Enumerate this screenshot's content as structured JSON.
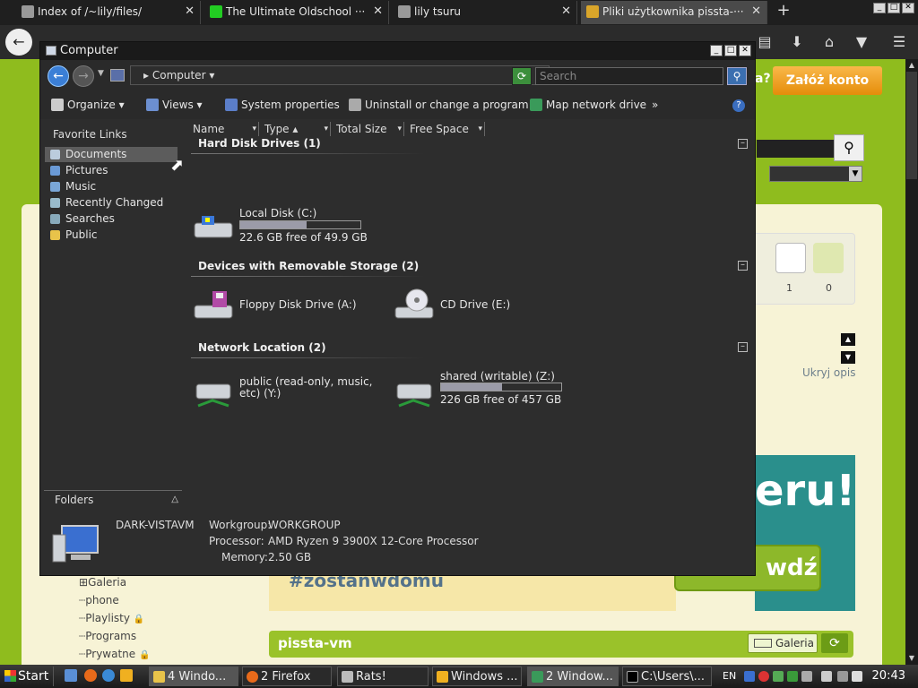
{
  "browser": {
    "tabs": [
      {
        "label": "Index of /~lily/files/",
        "close": "✕"
      },
      {
        "label": "The Ultimate Oldschool ···",
        "close": "✕"
      },
      {
        "label": "lily tsuru",
        "close": "✕"
      },
      {
        "label": "Pliki użytkownika pissta-···",
        "close": "✕"
      }
    ],
    "new_tab": "+",
    "win_buttons": [
      "_",
      "□",
      "✕"
    ]
  },
  "webpage": {
    "signup_button": "Załóż konto",
    "help_mark": "a?",
    "counts": [
      "1",
      "0"
    ],
    "hide_desc": "Ukryj opis",
    "banner_text": "eru!",
    "banner_button": "wdź",
    "hashtag": "#zostanwdomu",
    "tree": [
      "Galeria",
      "phone",
      "Playlisty",
      "Programs",
      "Prywatne"
    ],
    "section_title": "pissta-vm",
    "gallery_button": "Galeria"
  },
  "explorer": {
    "title": "Computer",
    "address": "Computer",
    "search_placeholder": "Search",
    "toolbar": {
      "organize": "Organize",
      "views": "Views",
      "system_properties": "System properties",
      "uninstall": "Uninstall or change a program",
      "map_drive": "Map network drive",
      "more": "»"
    },
    "favorites_header": "Favorite Links",
    "favorites": [
      "Documents",
      "Pictures",
      "Music",
      "Recently Changed",
      "Searches",
      "Public"
    ],
    "folders_label": "Folders",
    "columns": [
      "Name",
      "Type",
      "Total Size",
      "Free Space"
    ],
    "groups": {
      "hdd": "Hard Disk Drives (1)",
      "removable": "Devices with Removable Storage (2)",
      "network": "Network Location (2)"
    },
    "drives": {
      "c": {
        "name": "Local Disk (C:)",
        "free_text": "22.6 GB free of 49.9 GB",
        "used_fraction": 0.55
      },
      "a": {
        "name": "Floppy Disk Drive (A:)"
      },
      "e": {
        "name": "CD Drive (E:)"
      },
      "y": {
        "name_line1": "public (read-only, music,",
        "name_line2": "etc) (Y:)"
      },
      "z": {
        "name": "shared (writable) (Z:)",
        "free_text": "226 GB free of 457 GB",
        "used_fraction": 0.51
      }
    },
    "details": {
      "computer_name": "DARK-VISTAVM",
      "workgroup_label": "Workgroup:",
      "workgroup": "WORKGROUP",
      "processor_label": "Processor:",
      "processor": "AMD Ryzen 9 3900X 12-Core Processor",
      "memory_label": "Memory:",
      "memory": "2.50 GB"
    }
  },
  "taskbar": {
    "start": "Start",
    "buttons": [
      "4 Windo...",
      "2 Firefox",
      "Rats!",
      "Windows ...",
      "2 Window...",
      "C:\\Users\\..."
    ],
    "lang": "EN",
    "clock": "20:43"
  }
}
